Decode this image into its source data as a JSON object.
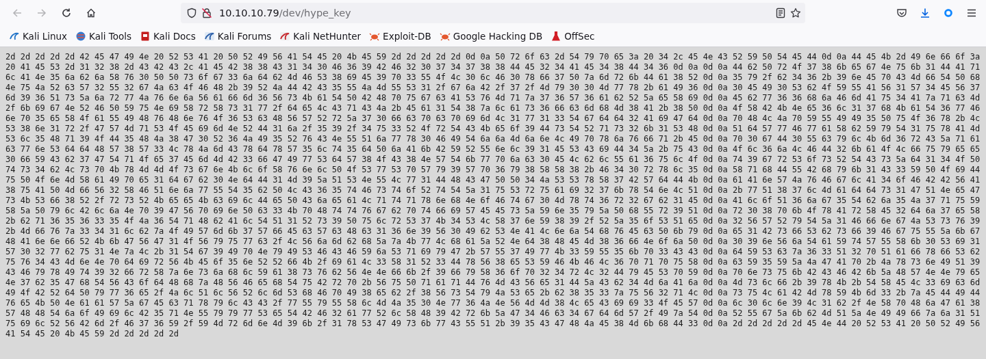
{
  "toolbar": {
    "url": {
      "host": "10.10.10.79",
      "path": "/dev/hype_key"
    }
  },
  "bookmarks": [
    "Kali Linux",
    "Kali Tools",
    "Kali Docs",
    "Kali Forums",
    "Kali NetHunter",
    "Exploit-DB",
    "Google Hacking DB",
    "OffSec"
  ],
  "lines": [
    "2d 2d 2d 2d 2d 42 45 47 49 4e 20 52 53 41 20 50 52 49 56 41 54 45 20 4b 45 59 2d 2d 2d 2d 2d 0d 0a 50 72 6f 63 2d 54 79 70 65 3a 20 34 2c 45 4e 43 52 59 50 54 45 44 0d 0a 44 45 4b 2d 49 6e 66 6f 3a",
    "20 41 45 53 2d 31 32 38 2d 43 42 43 2c 41 45 42 38 38 43 31 34 30 46 36 39 42 46 32 30 37 34 37 38 38 44 45 32 34 41 45 34 38 44 34 36 0d 0a 0d 0a 44 62 50 72 4f 37 38 6b 65 67 4e 75 6b 31 44 41 71",
    "6c 41 4e 35 6a 62 6a 58 76 30 50 50 73 6f 67 33 6a 64 62 4d 46 53 38 69 45 39 70 33 55 4f 4c 30 6c 46 30 78 66 37 50 7a 6d 72 6b 44 61 38 52 0d 0a 35 79 2f 62 34 36 2b 39 6e 45 70 43 4d 66 54 50 68",
    "4e 75 4a 52 63 57 32 55 32 67 4a 63 4f 46 48 2b 39 52 4a 44 42 43 35 55 4a 4d 55 53 31 2f 67 6a 42 2f 37 2f 4d 79 30 30 4d 77 78 2b 61 49 36 0d 0a 30 45 49 30 53 62 4f 59 55 41 56 31 57 34 45 56 37",
    "6d 39 36 51 73 5a 6a 72 77 4a 76 6e 6a 56 61 66 6d 36 56 73 4b 61 54 50 42 48 70 75 67 63 41 53 76 4d 71 7a 37 36 57 36 61 62 52 5a 65 58 69 0d 0a 45 62 77 36 36 68 6a 46 6d 41 75 34 41 7a 71 63 4d",
    "2f 6b 69 67 4e 52 46 50 59 75 4e 69 58 72 58 73 31 77 2f 64 65 4c 43 71 43 4a 2b 45 61 31 54 38 7a 6c 61 73 36 66 63 6d 68 4d 38 41 2b 38 50 0d 0a 4f 58 42 4b 4e 65 36 6c 31 37 68 4b 61 54 36 77 46",
    "6e 70 35 65 58 4f 61 55 49 48 76 48 6e 76 4f 36 53 63 48 56 57 52 72 5a 37 30 66 63 70 63 70 69 6d 4c 31 77 31 33 54 67 64 64 32 41 69 47 64 0d 0a 70 48 4c 4a 70 59 55 49 49 35 50 75 4f 36 78 2b 4c",
    "53 38 6e 31 72 2f 47 57 4d 71 53 4f 45 69 6d 4e 52 44 31 6a 2f 35 39 2f 34 75 33 52 4f 72 54 43 4b 65 6f 39 44 73 54 52 71 73 32 6b 31 53 48 0d 0a 51 64 57 77 46 77 61 58 62 59 79 54 31 75 78 41 4d",
    "53 6c 35 48 71 39 4f 44 35 48 4a 38 47 30 52 36 4a 49 35 52 76 43 4e 55 51 6a 77 78 30 46 49 54 6a 6a 4d 6a 6e 4c 49 70 78 6a 76 66 71 2b 45 0d 0a 70 30 67 44 30 55 63 79 6c 4b 6d 36 72 43 5a 71 61",
    "63 77 6e 53 64 64 48 57 38 57 33 4c 78 4a 6d 43 78 64 78 57 35 6c 74 35 64 50 6a 41 6b 42 59 52 55 6e 6c 39 31 45 53 43 69 44 34 5a 2b 75 43 0d 0a 4f 6c 36 6a 4c 46 44 32 6b 61 4f 4c 66 75 79 65 65",
    "30 66 59 43 62 37 47 54 71 4f 65 37 45 6d 4d 42 33 66 47 49 77 53 64 57 38 4f 43 38 4e 57 54 6b 77 70 6a 63 30 45 4c 62 6c 55 61 36 75 6c 4f 0d 0a 74 39 67 72 53 6f 73 52 54 43 73 5a 64 31 34 4f 50",
    "74 73 34 62 4c 73 70 4b 78 4d 4d 4f 73 67 6e 4b 6c 6f 58 76 6e 6c 50 4f 53 77 53 70 57 79 39 57 70 36 79 38 58 58 38 2b 46 34 30 72 78 6c 35 0d 0a 58 71 68 44 55 42 68 79 6b 31 43 33 59 50 4f 69 44",
    "75 50 4f 6e 4d 58 61 49 70 65 31 64 67 62 30 4e 64 44 31 4d 39 5a 51 53 4e 55 4c 77 31 44 48 43 47 50 50 34 4a 53 53 78 58 37 42 57 64 44 4b 0d 0a 61 41 6e 57 4a 76 46 67 6c 41 34 6f 46 42 42 56 41",
    "38 75 41 50 4d 66 56 32 58 46 51 6e 6a 77 55 54 35 62 50 4c 43 36 35 74 46 73 74 6f 52 74 54 5a 31 75 53 72 75 61 69 32 37 6b 78 54 6e 4c 51 0d 0a 2b 77 51 38 37 6c 4d 61 64 64 73 31 47 51 4e 65 47",
    "73 4b 53 66 38 52 2f 72 73 52 4b 65 65 4b 63 69 6c 44 65 50 43 6a 65 61 4c 71 74 71 78 6e 68 4e 6f 46 74 67 30 4d 78 74 36 72 32 67 62 31 45 0d 0a 41 6c 6f 51 36 6a 67 35 54 62 6a 35 4a 37 71 75 59",
    "58 5a 50 79 6c 42 6c 6a 4e 70 39 47 56 70 69 6e 50 63 33 4b 70 48 74 74 76 67 62 70 74 66 69 57 45 45 73 5a 59 6e 35 79 5a 50 68 55 72 39 51 0d 0a 72 30 38 70 6b 4f 78 41 72 58 45 32 64 6a 37 65 58",
    "2b 62 71 36 35 36 33 35 4f 4a 36 54 71 48 62 41 6c 54 51 31 52 73 39 50 75 6c 72 53 37 4b 34 53 4c 58 37 6e 59 38 39 2f 52 5a 35 6f 53 51 65 0d 0a 32 56 57 52 79 54 5a 31 46 66 6e 67 4a 53 73 76 39",
    "2b 4d 66 76 7a 33 34 31 6c 62 7a 4f 49 57 6d 6b 37 57 66 45 63 57 63 48 63 31 36 6e 39 56 30 49 62 53 4e 41 4c 6e 6a 54 68 76 45 63 50 6b 79 0d 0a 65 31 42 73 66 53 62 73 66 39 46 67 75 55 5a 6b 67",
    "48 41 6e 6e 66 52 4b 6b 47 56 47 31 4f 56 79 75 77 63 2f 4c 56 6a 6d 62 68 5a 7a 4b 77 4c 68 61 5a 52 4e 64 38 48 45 4d 38 36 66 4e 6f 6a 50 0d 0a 30 39 6e 56 6a 54 61 59 74 57 55 58 6b 30 53 69 31",
    "57 30 32 77 62 75 31 4e 7a 4c 2b 31 54 67 39 49 70 4e 79 49 53 46 43 46 59 6a 53 71 69 79 47 2b 57 55 37 49 77 4b 33 59 55 35 6b 70 33 43 43 0d 0a 64 59 53 63 7a 36 33 51 32 70 51 61 66 78 66 53 62",
    "75 76 34 43 4d 6e 4e 70 64 69 72 56 4b 45 6f 35 6e 52 52 66 4b 2f 69 61 4c 33 58 31 52 33 44 78 56 38 65 53 59 46 4b 46 4c 36 70 71 70 75 58 0d 0a 63 59 35 59 5a 4a 47 41 70 2b 4a 78 73 6e 49 51 39",
    "43 46 79 78 49 74 39 32 66 72 58 7a 6e 73 6a 68 6c 59 61 38 73 76 62 56 4e 4e 66 6b 2f 39 66 79 58 36 6f 70 32 34 72 4c 32 44 79 45 53 70 59 0d 0a 70 6e 73 75 6b 42 43 46 42 6b 5a 48 57 4e 4e 79 65",
    "4e 37 62 35 47 68 54 56 43 6f 64 48 68 7a 48 56 46 65 68 54 75 42 72 70 2b 56 75 50 71 61 71 44 76 4d 43 56 65 31 44 5a 43 62 34 4d 6a 41 6a 0d 0a 4d 73 6c 66 2b 39 78 4b 2b 54 58 45 4c 33 69 63 6d",
    "49 4f 42 52 64 50 79 77 36 65 2f 4a 6c 51 6c 56 52 6c 6d 53 68 46 70 49 38 65 62 2f 38 56 73 54 79 4a 53 65 2b 62 38 35 33 7a 75 56 32 71 4c 0d 0a 73 75 4c 61 42 4d 78 59 4b 6d 33 2b 7a 45 44 49 44",
    "76 65 4b 50 4e 61 61 57 5a 67 45 63 71 78 79 6c 43 43 2f 77 55 79 55 58 6c 4d 4a 35 30 4e 77 36 4a 4e 56 4d 4d 38 4c 65 43 69 69 33 4f 45 57 0d 0a 6c 30 6c 6e 39 4c 31 62 2f 4e 58 70 48 6a 47 61 38",
    "57 48 48 54 6a 6f 49 69 6c 42 35 71 4e 55 79 79 77 53 65 54 42 46 32 61 77 52 6c 58 48 39 42 72 6b 5a 47 34 46 63 34 67 64 6d 57 2f 49 7a 54 0d 0a 52 55 67 5a 6b 62 4d 51 5a 4e 49 49 66 7a 6a 31 51",
    "75 69 6c 52 56 42 6d 2f 46 37 36 59 2f 59 4d 72 6d 6e 4d 39 6b 2f 31 78 53 47 49 73 6b 77 43 55 51 2b 39 35 43 47 48 4a 45 38 4d 6b 68 44 33 0d 0a 2d 2d 2d 2d 2d 45 4e 44 20 52 53 41 20 50 52 49 56",
    "41 54 45 20 4b 45 59 2d 2d 2d 2d 2d"
  ]
}
